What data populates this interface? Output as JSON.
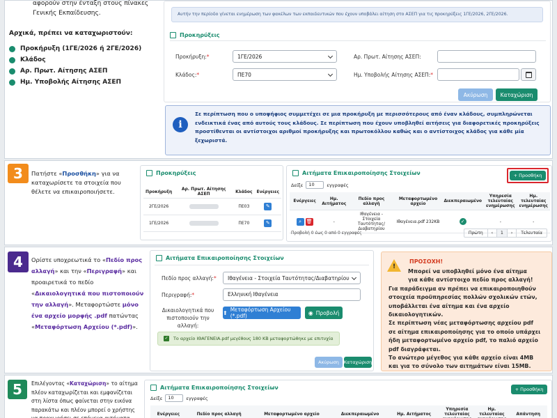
{
  "step1": {
    "intro_line1": "αφορούν στην ένταξη στους πίνακες",
    "intro_line2": "Γενικής Εκπαίδευσης.",
    "must_register": "Αρχικά, πρέπει να καταχωριστούν:",
    "items": [
      "Προκήρυξη (1ΓΕ/2026 ή 2ΓΕ/2026)",
      "Κλάδος",
      "Αρ. Πρωτ. Αίτησης ΑΣΕΠ",
      "Ημ. Υποβολής Αίτησης ΑΣΕΠ"
    ],
    "notice": "Αυτήν την περίοδο γίνεται ενημέρωση των φακέλων των εκπαιδευτικών που έχουν υποβάλει αίτηση στο ΑΣΕΠ για τις προκηρύξεις 1ΓΕ/2026, 2ΓΕ/2026.",
    "panel_title": "Προκηρύξεις",
    "proclamation_label": "Προκήρυξη:",
    "proclamation_value": "1ΓΕ/2026",
    "branch_label": "Κλάδος:",
    "branch_value": "ΠΕ70",
    "prot_label": "Αρ. Πρωτ. Αίτησης ΑΣΕΠ:",
    "date_label": "Ημ. Υποβολής Αίτησης ΑΣΕΠ:",
    "cancel": "Ακύρωση",
    "submit": "Καταχώριση",
    "info_text": "Σε περίπτωση που ο υποψήφιος συμμετέχει σε μια προκήρυξη με περισσότερους από έναν κλάδους, συμπληρώνεται ενδεικτικά ένας από αυτούς τους κλάδους. Σε περίπτωση που έχουν υποβληθεί αιτήσεις για διαφορετικές προκηρύξεις προστίθενται οι αντίστοιχοι αριθμοί προκήρυξης και πρωτοκόλλου καθώς και ο αντίστοιχος κλάδος για κάθε μία ξεχωριστά."
  },
  "step3": {
    "number": "3",
    "text_pre": "Πατήστε «",
    "text_bold": "Προσθήκη",
    "text_post": "» για να καταχωρίσετε τα στοιχεία που θέλετε να επικαιροποιήσετε.",
    "card_title": "Προκηρύξεις",
    "cols": [
      "Προκήρυξη",
      "Αρ. Πρωτ. Αίτησης ΑΣΕΠ",
      "Κλάδος",
      "Ενέργειες"
    ],
    "rows": [
      {
        "p": "2ΓΕ/2026",
        "k": "ΠΕ03"
      },
      {
        "p": "1ΓΕ/2026",
        "k": "ΠΕ70"
      }
    ],
    "req_title": "Αιτήματα Επικαιροποίησης Στοιχείων",
    "add_button": "+ Προσθήκη",
    "show": "Δείξε",
    "page_size": "10",
    "entries": "εγγραφές",
    "req_cols": [
      "Ενέργειες",
      "Ημ. Αιτήματος",
      "Πεδίο προς αλλαγή",
      "Μεταφορτωμένο αρχείο",
      "Διεκπεραιωμένο",
      "Υπηρεσία τελευταίας ενημέρωσης",
      "Ημ. τελευταίας ενημέρωσης"
    ],
    "req_row": {
      "date": "-",
      "field": "Ιθαγένεια - Στοιχεία Ταυτότητας/Διαβατηρίου",
      "file": "Ιθαγένεια.pdf   232KB",
      "svc": "-",
      "udate": "-"
    },
    "summary": "Προβολή 0 έως 0 από 0 εγγραφές",
    "first": "Πρώτη",
    "prev": "‹",
    "page": "1",
    "next": "›",
    "last": "Τελευταία"
  },
  "step4": {
    "number": "4",
    "p1": "Ορίστε υποχρεωτικά το «",
    "p1b": "Πεδίο προς αλλαγή",
    "p2": "» και την «",
    "p2b": "Περιγραφή",
    "p3": "» και προαιρετικά το πεδίο «",
    "p3b": "Δικαιολογητικά που πιστοποιούν την αλλαγή",
    "p4": "». Μεταφορτώστε ",
    "p4b": "μόνο ένα αρχείο μορφής .pdf",
    "p5": " πατώντας «",
    "p5b": "Μεταφόρτωση Αρχείου (*.pdf)",
    "p6": "».",
    "card_title": "Αιτήματα Επικαιροποίησης Στοιχείων",
    "field_label": "Πεδίο προς αλλαγή:",
    "field_value": "Ιθαγένεια - Στοιχεία Ταυτότητας/Διαβατηρίου",
    "desc_label": "Περιγραφή:",
    "desc_value": "Ελληνική Ιθαγένεια",
    "docs_label": "Δικαιολογητικά που πιστοποιούν την αλλαγή:",
    "upload": "Μεταφόρτωση Αρχείου (*.pdf)",
    "view": "Προβολή",
    "success": "Το αρχείο ΙΘΑΓΕΝΕΙΑ.pdf μεγέθους 180 KB μεταφορτώθηκε με επιτυχία",
    "cancel": "Ακύρωση",
    "submit": "Καταχώριση",
    "warn_title": "ΠΡΟΣΟΧΗ!",
    "warn_lines": [
      "Μπορεί να υποβληθεί μόνο ένα αίτημα",
      "για κάθε αντίστοιχο πεδίο προς αλλαγή!",
      "Για παράδειγμα αν πρέπει να επικαιροποιηθούν",
      "στοιχεία προϋπηρεσίας πολλών σχολικών ετών,",
      "υποβάλλεται ένα αίτημα και ένα αρχείο",
      "δικαιολογητικών.",
      "Σε περίπτωση νέας μεταφόρτωσης αρχείου pdf",
      "σε αίτημα επικαιροποίησης για το οποίο υπάρχει",
      "ήδη μεταφορτωμένο αρχείο pdf, το παλιό αρχείο",
      "pdf διαγράφεται.",
      "Το ανώτερο μέγεθος για κάθε αρχείο είναι 4MB",
      "και για το σύνολο των αιτημάτων είναι 15MB."
    ]
  },
  "step5": {
    "number": "5",
    "t1": "Επιλέγοντας «",
    "t1b": "Καταχώριση",
    "t2": "» το αίτημα πλέον καταχωρίζεται και εμφανίζεται στη λίστα όπως φαίνεται στην εικόνα παρακάτω και πλέον μπορεί ο χρήστης να προχωρήσει σε επόμενα αιτήματα.",
    "card_title": "Αιτήματα Επικαιροποίησης Στοιχείων",
    "add_button": "+ Προσθήκη",
    "show": "Δείξε",
    "page_size": "10",
    "entries": "εγγραφές",
    "cols": [
      "Ενέργειες",
      "Πεδίο προς αλλαγή",
      "Μεταφορτωμένο αρχείο",
      "Διεκπεραιωμένο",
      "Ημ. Αιτήματος",
      "Υπηρεσία τελευταίας ενημέρωσης",
      "Ημ. τελευταίας ενημέρωσης",
      "Απάντηση"
    ]
  },
  "colors": {
    "teal": "#1a8c6e",
    "blue": "#2f7fd4",
    "purple": "#4b2a8e",
    "orange": "#f28c1c"
  }
}
